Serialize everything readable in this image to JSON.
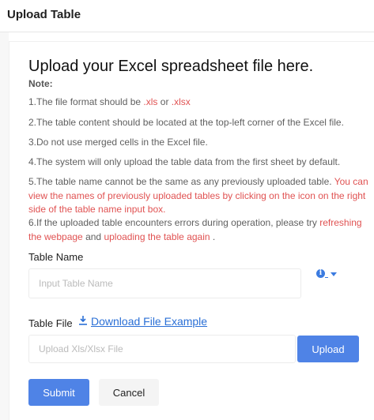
{
  "header": {
    "title": "Upload Table"
  },
  "main": {
    "heading": "Upload your Excel spreadsheet file here.",
    "note_label": "Note:",
    "rules": {
      "r1_text": "1.The file format should be ",
      "r1_xls": ".xls",
      "r1_or": " or ",
      "r1_xlsx": ".xlsx",
      "r2": "2.The table content should be located at the top-left corner of the Excel file.",
      "r3": "3.Do not use merged cells in the Excel file.",
      "r4": "4.The system will only upload the table data from the first sheet by default.",
      "r5_text": "5.The table name cannot be the same as any previously uploaded table. ",
      "r5_red": "You can view the names of previously uploaded tables by clicking on the icon on the right side of the table name input box.",
      "r6_text": "6.If the uploaded table encounters errors during operation, please try ",
      "r6_link1": "refreshing the webpage",
      "r6_and": " and ",
      "r6_link2": "uploading the table again",
      "r6_end": " ."
    },
    "table_name": {
      "label": "Table Name",
      "placeholder": "Input Table Name",
      "info_icon": "info-icon",
      "dropdown_icon": "chevron-down-icon"
    },
    "table_file": {
      "label": "Table File",
      "download_icon": "download-icon",
      "download_label": "Download File Example",
      "placeholder": "Upload Xls/Xlsx File",
      "upload_label": "Upload"
    },
    "actions": {
      "submit_label": "Submit",
      "cancel_label": "Cancel"
    }
  },
  "colors": {
    "accent": "#4f83e6",
    "link": "#2a6fd6",
    "warning": "#e05252"
  }
}
